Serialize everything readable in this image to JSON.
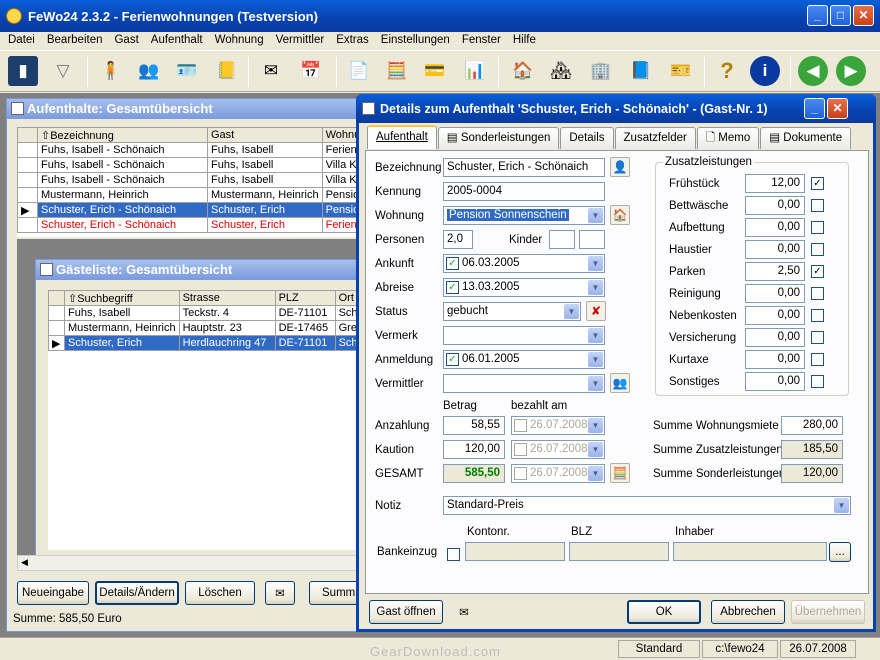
{
  "app": {
    "title": "FeWo24 2.3.2  -  Ferienwohnungen (Testversion)",
    "menu": [
      "Datei",
      "Bearbeiten",
      "Gast",
      "Aufenthalt",
      "Wohnung",
      "Vermittler",
      "Extras",
      "Einstellungen",
      "Fenster",
      "Hilfe"
    ],
    "status": {
      "mode": "Standard",
      "path": "c:\\fewo24",
      "date": "26.07.2008"
    }
  },
  "aufenthalte": {
    "title": "Aufenthalte: Gesamtübersicht",
    "columns": [
      "⇧Bezeichnung",
      "Gast",
      "Wohnu"
    ],
    "rows": [
      [
        "Fuhs, Isabell - Schönaich",
        "Fuhs, Isabell",
        "Feriendo"
      ],
      [
        "Fuhs, Isabell - Schönaich",
        "Fuhs, Isabell",
        "Villa Kur"
      ],
      [
        "Fuhs, Isabell - Schönaich",
        "Fuhs, Isabell",
        "Villa Kur"
      ],
      [
        "Mustermann, Heinrich",
        "Mustermann, Heinrich",
        "Pension"
      ],
      [
        "Schuster, Erich - Schönaich",
        "Schuster, Erich",
        "Pension"
      ],
      [
        "Schuster, Erich - Schönaich",
        "Schuster, Erich",
        "Ferienc"
      ]
    ],
    "buttons": {
      "new": "Neueingabe",
      "details": "Details/Ändern",
      "delete": "Löschen",
      "sum": "Summ"
    },
    "summe": "Summe: 585,50 Euro"
  },
  "gaeste": {
    "title": "Gästeliste: Gesamtübersicht",
    "columns": [
      "⇧Suchbegriff",
      "Strasse",
      "PLZ",
      "Ort"
    ],
    "rows": [
      [
        "Fuhs, Isabell",
        "Teckstr. 4",
        "DE-71101",
        "Schö"
      ],
      [
        "Mustermann, Heinrich",
        "Hauptstr. 23",
        "DE-17465",
        "Greif"
      ],
      [
        "Schuster, Erich",
        "Herdlauchring 47",
        "DE-71101",
        "Schö"
      ]
    ]
  },
  "details": {
    "title": "Details zum Aufenthalt 'Schuster, Erich - Schönaich' - (Gast-Nr. 1)",
    "tabs": [
      "Aufenthalt",
      "Sonderleistungen",
      "Details",
      "Zusatzfelder",
      "Memo",
      "Dokumente"
    ],
    "labels": {
      "bezeichnung": "Bezeichnung",
      "kennung": "Kennung",
      "wohnung": "Wohnung",
      "personen": "Personen",
      "kinder": "Kinder",
      "ankunft": "Ankunft",
      "abreise": "Abreise",
      "status": "Status",
      "vermerk": "Vermerk",
      "anmeldung": "Anmeldung",
      "vermittler": "Vermittler",
      "betrag": "Betrag",
      "bezahlt": "bezahlt am",
      "anzahlung": "Anzahlung",
      "kaution": "Kaution",
      "gesamt": "GESAMT",
      "notiz": "Notiz",
      "bankeinzug": "Bankeinzug",
      "kontonr": "Kontonr.",
      "blz": "BLZ",
      "inhaber": "Inhaber",
      "zusatz": "Zusatzleistungen",
      "summe_wohnung": "Summe Wohnungsmiete",
      "summe_zusatz": "Summe Zusatzleistungen",
      "summe_sonder": "Summe Sonderleistungen"
    },
    "values": {
      "bezeichnung": "Schuster, Erich - Schönaich",
      "kennung": "2005-0004",
      "wohnung": "Pension Sonnenschein",
      "personen": "2,0",
      "ankunft": "06.03.2005",
      "abreise": "13.03.2005",
      "status": "gebucht",
      "anmeldung": "06.01.2005",
      "anzahlung": "58,55",
      "kaution": "120,00",
      "gesamt": "585,50",
      "bez_date1": "26.07.2008",
      "bez_date2": "26.07.2008",
      "bez_date3": "26.07.2008",
      "notiz": "Standard-Preis",
      "summe_wohnung": "280,00",
      "summe_zusatz": "185,50",
      "summe_sonder": "120,00"
    },
    "zusatz": [
      {
        "label": "Frühstück",
        "value": "12,00",
        "checked": true
      },
      {
        "label": "Bettwäsche",
        "value": "0,00",
        "checked": false
      },
      {
        "label": "Aufbettung",
        "value": "0,00",
        "checked": false
      },
      {
        "label": "Haustier",
        "value": "0,00",
        "checked": false
      },
      {
        "label": "Parken",
        "value": "2,50",
        "checked": true
      },
      {
        "label": "Reinigung",
        "value": "0,00",
        "checked": false
      },
      {
        "label": "Nebenkosten",
        "value": "0,00",
        "checked": false
      },
      {
        "label": "Versicherung",
        "value": "0,00",
        "checked": false
      },
      {
        "label": "Kurtaxe",
        "value": "0,00",
        "checked": false
      },
      {
        "label": "Sonstiges",
        "value": "0,00",
        "checked": false
      }
    ],
    "buttons": {
      "gast": "Gast öffnen",
      "ok": "OK",
      "cancel": "Abbrechen",
      "apply": "Übernehmen",
      "browse": "..."
    }
  },
  "watermark": "GearDownload.com"
}
